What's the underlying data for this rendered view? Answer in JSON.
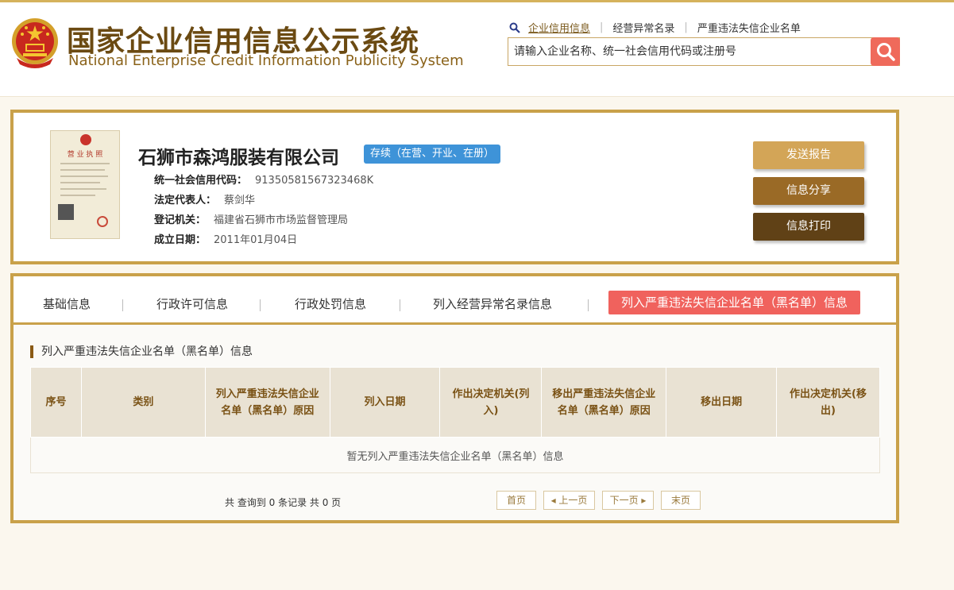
{
  "header": {
    "title_cn": "国家企业信用信息公示系统",
    "title_en": "National Enterprise Credit Information Publicity System",
    "nav": [
      "企业信用信息",
      "经营异常名录",
      "严重违法失信企业名单"
    ],
    "search_placeholder": "请输入企业名称、统一社会信用代码或注册号"
  },
  "company": {
    "name": "石狮市森鸿服装有限公司",
    "status": "存续（在营、开业、在册）",
    "license_title": "营 业 执 照",
    "fields": [
      {
        "label": "统一社会信用代码：",
        "value": "91350581567323468K"
      },
      {
        "label": "法定代表人：",
        "value": "蔡剑华"
      },
      {
        "label": "登记机关：",
        "value": "福建省石狮市市场监督管理局"
      },
      {
        "label": "成立日期：",
        "value": "2011年01月04日"
      }
    ],
    "buttons": [
      "发送报告",
      "信息分享",
      "信息打印"
    ]
  },
  "tabs": [
    "基础信息",
    "行政许可信息",
    "行政处罚信息",
    "列入经营异常名录信息",
    "列入严重违法失信企业名单（黑名单）信息"
  ],
  "active_tab": "列入严重违法失信企业名单（黑名单）信息",
  "section_title": "列入严重违法失信企业名单（黑名单）信息",
  "table": {
    "headers": [
      "序号",
      "类别",
      "列入严重违法失信企业名单（黑名单）原因",
      "列入日期",
      "作出决定机关(列入)",
      "移出严重违法失信企业名单（黑名单）原因",
      "移出日期",
      "作出决定机关(移出)"
    ],
    "empty_text": "暂无列入严重违法失信企业名单（黑名单）信息"
  },
  "pager": {
    "total_text": "共 查询到 0 条记录 共 0 页",
    "first": "首页",
    "prev": "上一页",
    "next": "下一页",
    "last": "末页"
  },
  "colors": {
    "gold_border": "#c9a14a",
    "brand_brown": "#6b4a12",
    "status_blue": "#3e93d8",
    "active_tab_red": "#f0625d",
    "search_red": "#ef6a5b"
  }
}
